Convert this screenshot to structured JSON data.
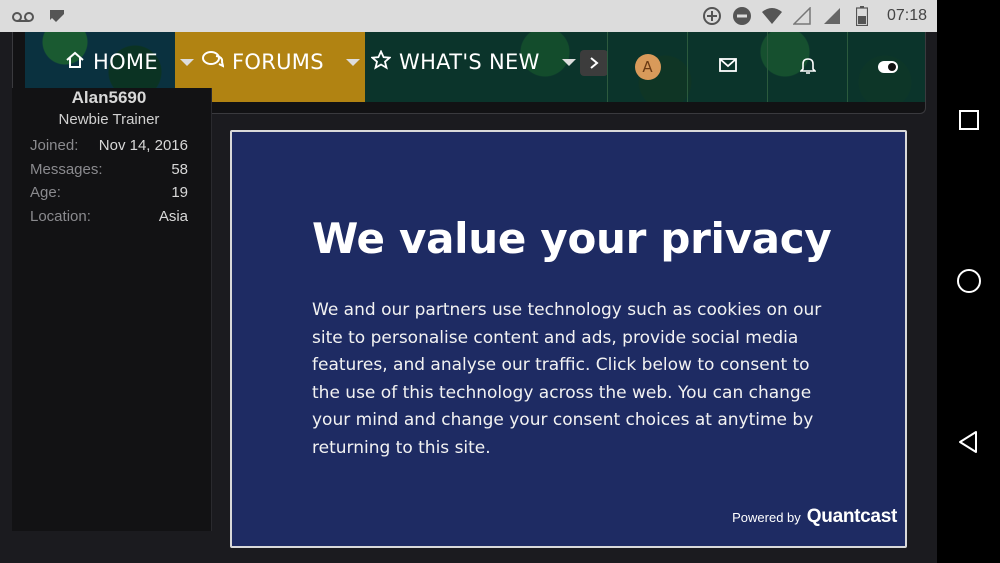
{
  "status_bar": {
    "time": "07:18",
    "left_icons": [
      "voicemail-icon",
      "check-icon"
    ],
    "right_icons": [
      "data-saver-icon",
      "do-not-disturb-icon",
      "wifi-icon",
      "signal-icon",
      "signal-icon",
      "battery-icon"
    ]
  },
  "nav": {
    "items": [
      {
        "label": "HOME",
        "icon": "home-icon"
      },
      {
        "label": "FORUMS",
        "icon": "forums-icon"
      },
      {
        "label": "WHAT'S NEW",
        "icon": "star-icon"
      }
    ],
    "avatar_letter": "A"
  },
  "user": {
    "name": "Alan5690",
    "title": "Newbie Trainer",
    "stats": [
      {
        "key": "Joined:",
        "value": "Nov 14, 2016"
      },
      {
        "key": "Messages:",
        "value": "58"
      },
      {
        "key": "Age:",
        "value": "19"
      },
      {
        "key": "Location:",
        "value": "Asia"
      }
    ]
  },
  "privacy": {
    "title": "We value your privacy",
    "body": "We and our partners use technology such as cookies on our site to personalise content and ads, provide social media features, and analyse our traffic. Click below to consent to the use of this technology across the web. You can change your mind and change your consent choices at anytime by returning to this site.",
    "powered_by": "Powered by",
    "brand": "Quantcast"
  },
  "colors": {
    "modal_bg": "#1e2b63",
    "page_bg": "#1b1b1f",
    "status_bar_bg": "#dcdcdc"
  }
}
